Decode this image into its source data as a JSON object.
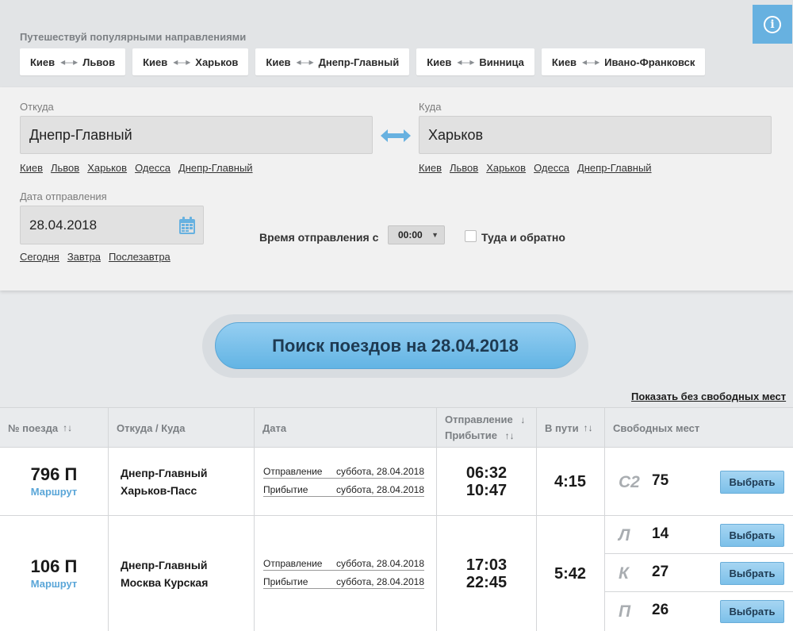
{
  "popular": {
    "title": "Путешествуй популярными направлениями",
    "arrow_glyph": "◂—▸",
    "routes": [
      {
        "from": "Киев",
        "to": "Львов"
      },
      {
        "from": "Киев",
        "to": "Харьков"
      },
      {
        "from": "Киев",
        "to": "Днепр-Главный"
      },
      {
        "from": "Киев",
        "to": "Винница"
      },
      {
        "from": "Киев",
        "to": "Ивано-Франковск"
      }
    ]
  },
  "info_icon": "i",
  "form": {
    "from_label": "Откуда",
    "from_value": "Днепр-Главный",
    "to_label": "Куда",
    "to_value": "Харьков",
    "quick_stations": [
      "Киев",
      "Львов",
      "Харьков",
      "Одесса",
      "Днепр-Главный"
    ],
    "date_label": "Дата отправления",
    "date_value": "28.04.2018",
    "date_quick": [
      "Сегодня",
      "Завтра",
      "Послезавтра"
    ],
    "time_label": "Время отправления с",
    "time_value": "00:00",
    "roundtrip_label": "Туда и обратно",
    "roundtrip_checked": false
  },
  "search_button": "Поиск поездов на 28.04.2018",
  "show_without_seats": "Показать без свободных мест",
  "table": {
    "headers": {
      "train_no": "№ поезда",
      "from_to": "Откуда / Куда",
      "date": "Дата",
      "departure": "Отправление",
      "arrival": "Прибытие",
      "duration": "В пути",
      "free_seats": "Свободных мест"
    },
    "rows": [
      {
        "train_no": "796 П",
        "route_link": "Маршрут",
        "from": "Днепр-Главный",
        "to": "Харьков-Пасс",
        "dep_label": "Отправление",
        "dep_date": "суббота, 28.04.2018",
        "arr_label": "Прибытие",
        "arr_date": "суббота, 28.04.2018",
        "dep_time": "06:32",
        "arr_time": "10:47",
        "duration": "4:15",
        "seats": [
          {
            "class": "С2",
            "count": "75",
            "button": "Выбрать"
          }
        ]
      },
      {
        "train_no": "106 П",
        "route_link": "Маршрут",
        "from": "Днепр-Главный",
        "to": "Москва Курская",
        "dep_label": "Отправление",
        "dep_date": "суббота, 28.04.2018",
        "arr_label": "Прибытие",
        "arr_date": "суббота, 28.04.2018",
        "dep_time": "17:03",
        "arr_time": "22:45",
        "duration": "5:42",
        "seats": [
          {
            "class": "Л",
            "count": "14",
            "button": "Выбрать"
          },
          {
            "class": "К",
            "count": "27",
            "button": "Выбрать"
          },
          {
            "class": "П",
            "count": "26",
            "button": "Выбрать"
          }
        ]
      }
    ]
  },
  "colors": {
    "accent": "#67b1e0",
    "button_blue": "#7cc0e9",
    "panel_bg": "#f1f1f1"
  }
}
